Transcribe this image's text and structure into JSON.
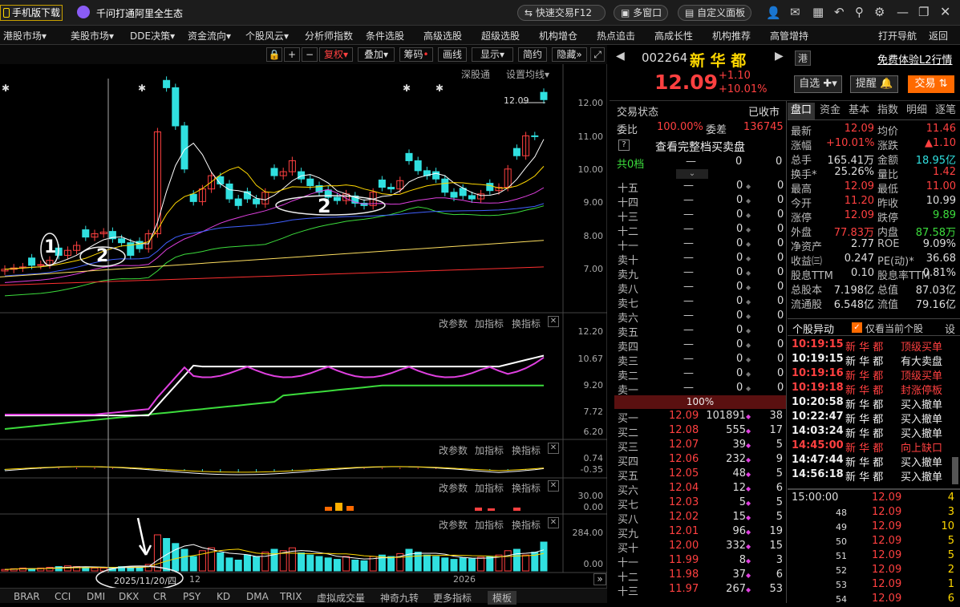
{
  "titlebar": {
    "mobile_download": "手机版下载",
    "promo": "千问打通阿里全生态",
    "quick_trade": "快速交易F12",
    "multi_window": "多窗口",
    "custom_panel": "自定义面板"
  },
  "menu": [
    "港股市场",
    "美股市场",
    "DDE决策",
    "资金流向",
    "个股风云",
    "分析师指数",
    "条件选股",
    "高级选股",
    "超级选股",
    "机构增仓",
    "热点追击",
    "高成长性",
    "机构推荐",
    "高管增持",
    "打开导航",
    "返回"
  ],
  "chart_toolbar": {
    "fuquan": "复权",
    "overlay": "叠加",
    "chips": "筹码",
    "draw": "画线",
    "display": "显示",
    "simple": "简约",
    "hide": "隐藏",
    "sz_connect": "深股通",
    "set_ma": "设置均线"
  },
  "price_axis": [
    "12.00",
    "11.00",
    "10.00",
    "9.00",
    "8.00",
    "7.00"
  ],
  "last_price_label": "12.09",
  "annotations": [
    "1",
    "2",
    "2"
  ],
  "indicator_headers": {
    "change_param": "改参数",
    "add_ind": "加指标",
    "switch_ind": "换指标"
  },
  "ind1_axis": [
    "12.20",
    "10.67",
    "9.20",
    "7.72",
    "6.20"
  ],
  "ind2_axis": [
    "0.74",
    "-0.35"
  ],
  "ind3_axis": [
    "30.00",
    "0.00"
  ],
  "ind4_axis": [
    "284.00",
    "0.00"
  ],
  "date_axis": {
    "cursor_date": "2025/11/20/四",
    "mid": "12",
    "year": "2026"
  },
  "bottom_tabs": [
    "BRAR",
    "CCI",
    "DMI",
    "DKX",
    "CR",
    "PSY",
    "KD",
    "DMA",
    "TRIX",
    "虚拟成交量",
    "神奇九转",
    "更多指标",
    "模板"
  ],
  "stock": {
    "code": "002264",
    "name": "新 华 都",
    "price": "12.09",
    "change": "+1.10",
    "change_pct": "+10.01%",
    "hk_tag": "港",
    "l2_promo": "免费体验L2行情",
    "watch_btn": "自选",
    "alert_btn": "提醒",
    "trade_btn": "交易"
  },
  "order_book": {
    "trade_status_label": "交易状态",
    "trade_status": "已收市",
    "wb_label": "委比",
    "wb": "100.00%",
    "wc_label": "委差",
    "wc": "136745",
    "full_book": "查看完整档买卖盘",
    "total_levels": "共0档",
    "dash": "—",
    "sell_levels": [
      "十五",
      "十四",
      "十三",
      "十二",
      "十一",
      "卖十",
      "卖九",
      "卖八",
      "卖七",
      "卖六",
      "卖五",
      "卖四",
      "卖三",
      "卖二",
      "卖一"
    ],
    "pct_bar": "100%",
    "buy_levels": [
      {
        "label": "买一",
        "price": "12.09",
        "vol": "101891",
        "n": "38"
      },
      {
        "label": "买二",
        "price": "12.08",
        "vol": "555",
        "n": "17"
      },
      {
        "label": "买三",
        "price": "12.07",
        "vol": "39",
        "n": "5"
      },
      {
        "label": "买四",
        "price": "12.06",
        "vol": "232",
        "n": "9"
      },
      {
        "label": "买五",
        "price": "12.05",
        "vol": "48",
        "n": "5"
      },
      {
        "label": "买六",
        "price": "12.04",
        "vol": "12",
        "n": "6"
      },
      {
        "label": "买七",
        "price": "12.03",
        "vol": "5",
        "n": "5"
      },
      {
        "label": "买八",
        "price": "12.02",
        "vol": "15",
        "n": "5"
      },
      {
        "label": "买九",
        "price": "12.01",
        "vol": "96",
        "n": "19"
      },
      {
        "label": "买十",
        "price": "12.00",
        "vol": "332",
        "n": "15"
      },
      {
        "label": "十一",
        "price": "11.99",
        "vol": "8",
        "n": "3"
      },
      {
        "label": "十二",
        "price": "11.98",
        "vol": "37",
        "n": "6"
      },
      {
        "label": "十三",
        "price": "11.97",
        "vol": "267",
        "n": "53"
      }
    ]
  },
  "tabs": [
    "盘口",
    "资金",
    "基本",
    "指数",
    "明细",
    "逐笔"
  ],
  "stats": [
    [
      "最新",
      "12.09",
      "均价",
      "11.46"
    ],
    [
      "涨幅",
      "+10.01%",
      "涨跌",
      "▲1.10"
    ],
    [
      "总手",
      "165.41万",
      "金额",
      "18.95亿"
    ],
    [
      "换手*",
      "25.26%",
      "量比",
      "1.42"
    ],
    [
      "最高",
      "12.09",
      "最低",
      "11.00"
    ],
    [
      "今开",
      "11.20",
      "昨收",
      "10.99"
    ],
    [
      "涨停",
      "12.09",
      "跌停",
      "9.89"
    ],
    [
      "外盘",
      "77.83万",
      "内盘",
      "87.58万"
    ],
    [
      "净资产",
      "2.77",
      "ROE",
      "9.09%"
    ],
    [
      "收益㈢",
      "0.247",
      "PE(动)*",
      "36.68"
    ],
    [
      "股息TTM",
      "0.10",
      "股息率TTM",
      "0.81%"
    ],
    [
      "总股本",
      "7.198亿",
      "总值",
      "87.03亿"
    ],
    [
      "流通股",
      "6.548亿",
      "流值",
      "79.16亿"
    ]
  ],
  "anomaly": {
    "title": "个股异动",
    "only_current": "仅看当前个股",
    "settings": "设",
    "rows": [
      {
        "time": "10:19:15",
        "name": "新 华 都",
        "event": "顶级买单"
      },
      {
        "time": "10:19:15",
        "name": "新 华 都",
        "event": "有大卖盘"
      },
      {
        "time": "10:19:16",
        "name": "新 华 都",
        "event": "顶级买单"
      },
      {
        "time": "10:19:18",
        "name": "新 华 都",
        "event": "封涨停板"
      },
      {
        "time": "10:20:58",
        "name": "新 华 都",
        "event": "买入撤单"
      },
      {
        "time": "10:22:47",
        "name": "新 华 都",
        "event": "买入撤单"
      },
      {
        "time": "14:03:24",
        "name": "新 华 都",
        "event": "买入撤单"
      },
      {
        "time": "14:45:00",
        "name": "新 华 都",
        "event": "向上缺口"
      },
      {
        "time": "14:47:44",
        "name": "新 华 都",
        "event": "买入撤单"
      },
      {
        "time": "14:56:18",
        "name": "新 华 都",
        "event": "买入撤单"
      }
    ]
  },
  "ticks": [
    {
      "t": "15:00:00",
      "p": "12.09",
      "v": "4"
    },
    {
      "t": "48",
      "p": "12.09",
      "v": "3"
    },
    {
      "t": "49",
      "p": "12.09",
      "v": "10"
    },
    {
      "t": "50",
      "p": "12.09",
      "v": "5"
    },
    {
      "t": "51",
      "p": "12.09",
      "v": "5"
    },
    {
      "t": "52",
      "p": "12.09",
      "v": "2"
    },
    {
      "t": "53",
      "p": "12.09",
      "v": "1"
    },
    {
      "t": "54",
      "p": "12.09",
      "v": "6"
    }
  ],
  "colors": {
    "up": "#ff4040",
    "down": "#30e0e0",
    "accent": "#ff6a00"
  }
}
